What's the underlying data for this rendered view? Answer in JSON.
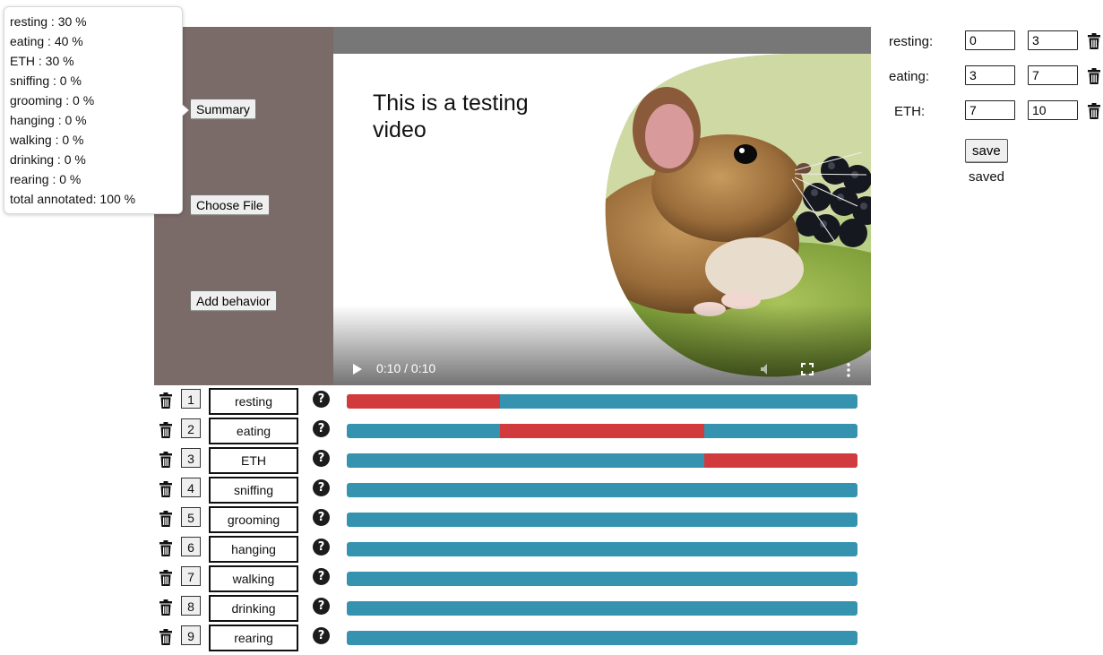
{
  "summary": {
    "lines": [
      "resting : 30 %",
      "eating : 40 %",
      "ETH : 30 %",
      "sniffing : 0 %",
      "grooming : 0 %",
      "hanging : 0 %",
      "walking : 0 %",
      "drinking : 0 %",
      "rearing : 0 %",
      "total annotated: 100 %"
    ]
  },
  "buttons": {
    "summary": "Summary",
    "choose_file": "Choose File",
    "add_behavior": "Add behavior",
    "save": "save"
  },
  "video": {
    "caption": "This is a testing video",
    "time": "0:10 / 0:10",
    "duration_s": 10,
    "position_s": 10
  },
  "annotations": [
    {
      "label": "resting:",
      "start": "0",
      "end": "3"
    },
    {
      "label": "eating:",
      "start": "3",
      "end": "7"
    },
    {
      "label": "ETH:",
      "start": "7",
      "end": "10"
    }
  ],
  "save_status": "saved",
  "behaviors": [
    {
      "num": "1",
      "name": "resting",
      "segments": [
        [
          0,
          3
        ]
      ]
    },
    {
      "num": "2",
      "name": "eating",
      "segments": [
        [
          3,
          7
        ]
      ]
    },
    {
      "num": "3",
      "name": "ETH",
      "segments": [
        [
          7,
          10
        ]
      ]
    },
    {
      "num": "4",
      "name": "sniffing",
      "segments": []
    },
    {
      "num": "5",
      "name": "grooming",
      "segments": []
    },
    {
      "num": "6",
      "name": "hanging",
      "segments": []
    },
    {
      "num": "7",
      "name": "walking",
      "segments": []
    },
    {
      "num": "8",
      "name": "drinking",
      "segments": []
    },
    {
      "num": "9",
      "name": "rearing",
      "segments": []
    }
  ],
  "help_glyph": "?",
  "colors": {
    "panel": "#7a6a68",
    "timeline_bg": "#3593b0",
    "timeline_segment": "#d13b3d"
  }
}
